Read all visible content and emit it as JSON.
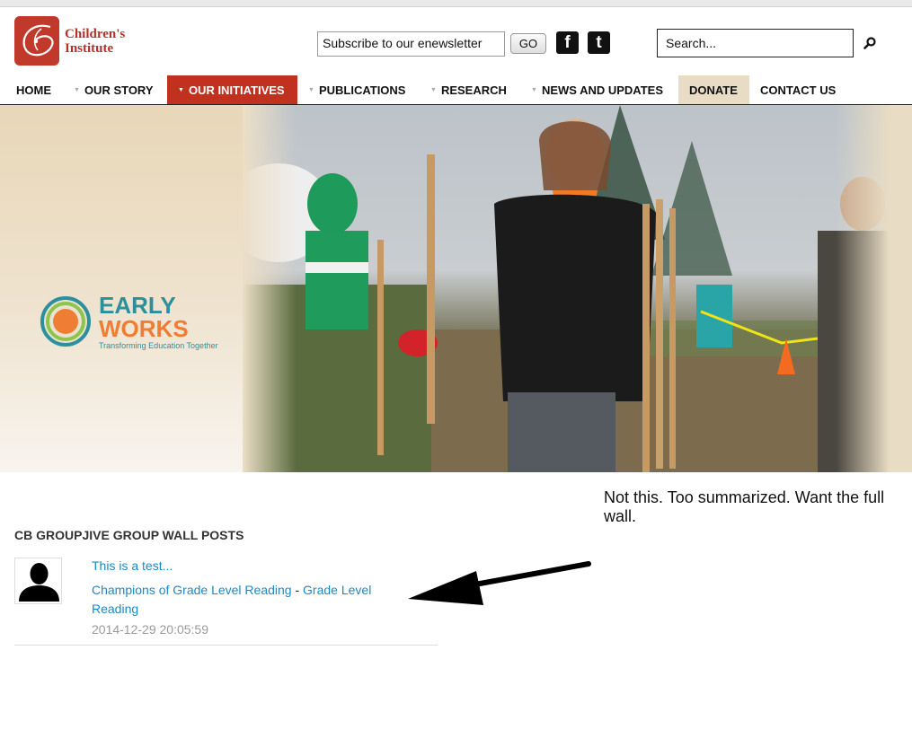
{
  "logo": {
    "line1": "Children's",
    "line2": "Institute"
  },
  "header": {
    "subscribe_text": "Subscribe to our enewsletter",
    "go_label": "GO",
    "facebook_glyph": "f",
    "twitter_glyph": "t",
    "search_placeholder": "Search..."
  },
  "nav": {
    "items": [
      {
        "label": "HOME"
      },
      {
        "label": "OUR STORY"
      },
      {
        "label": "OUR INITIATIVES"
      },
      {
        "label": "PUBLICATIONS"
      },
      {
        "label": "RESEARCH"
      },
      {
        "label": "NEWS AND UPDATES"
      },
      {
        "label": "DONATE"
      },
      {
        "label": "CONTACT US"
      }
    ]
  },
  "hero": {
    "brand_line1": "EARLY",
    "brand_line2": "WORKS",
    "tagline": "Transforming Education Together"
  },
  "annotation": {
    "text": "Not this. Too summarized. Want the full wall."
  },
  "wall": {
    "heading": "CB GROUPJIVE GROUP WALL POSTS",
    "post": {
      "title": "This is a test...",
      "group_link": "Champions of Grade Level Reading",
      "separator": "-",
      "category_link": "Grade Level Reading",
      "timestamp": "2014-12-29 20:05:59"
    }
  },
  "colors": {
    "brand_red": "#c0311f",
    "link_blue": "#1a8ac6",
    "donate_bg": "#e8dcc4",
    "teal": "#2c8f9e",
    "orange": "#ef7d33"
  }
}
